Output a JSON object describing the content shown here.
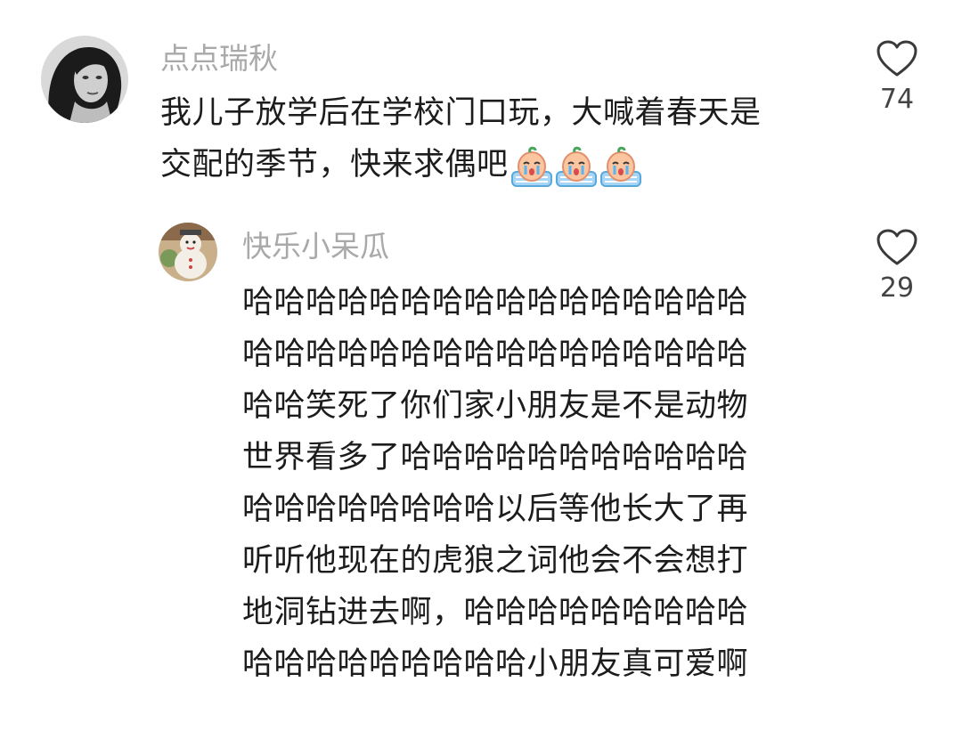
{
  "comments": [
    {
      "username": "点点瑞秋",
      "text_lines": [
        "我儿子放学后在学校门口玩，大喊着春天是",
        "交配的季节，快来求偶吧"
      ],
      "emoji": [
        "crying-emoji",
        "crying-emoji",
        "crying-emoji"
      ],
      "likes": "74",
      "avatar": "woman-portrait-avatar"
    },
    {
      "username": "快乐小呆瓜",
      "text_lines": [
        "哈哈哈哈哈哈哈哈哈哈哈哈哈哈哈哈",
        "哈哈哈哈哈哈哈哈哈哈哈哈哈哈哈哈",
        "哈哈笑死了你们家小朋友是不是动物",
        "世界看多了哈哈哈哈哈哈哈哈哈哈哈",
        "哈哈哈哈哈哈哈哈以后等他长大了再",
        "听听他现在的虎狼之词他会不会想打",
        "地洞钻进去啊，哈哈哈哈哈哈哈哈哈",
        "哈哈哈哈哈哈哈哈哈小朋友真可爱啊"
      ],
      "likes": "29",
      "avatar": "snowman-toy-avatar"
    }
  ],
  "colors": {
    "username": "#a9a9a9",
    "text": "#1c1c1c",
    "like_count": "#444444",
    "heart_stroke": "#3a3a3a"
  }
}
